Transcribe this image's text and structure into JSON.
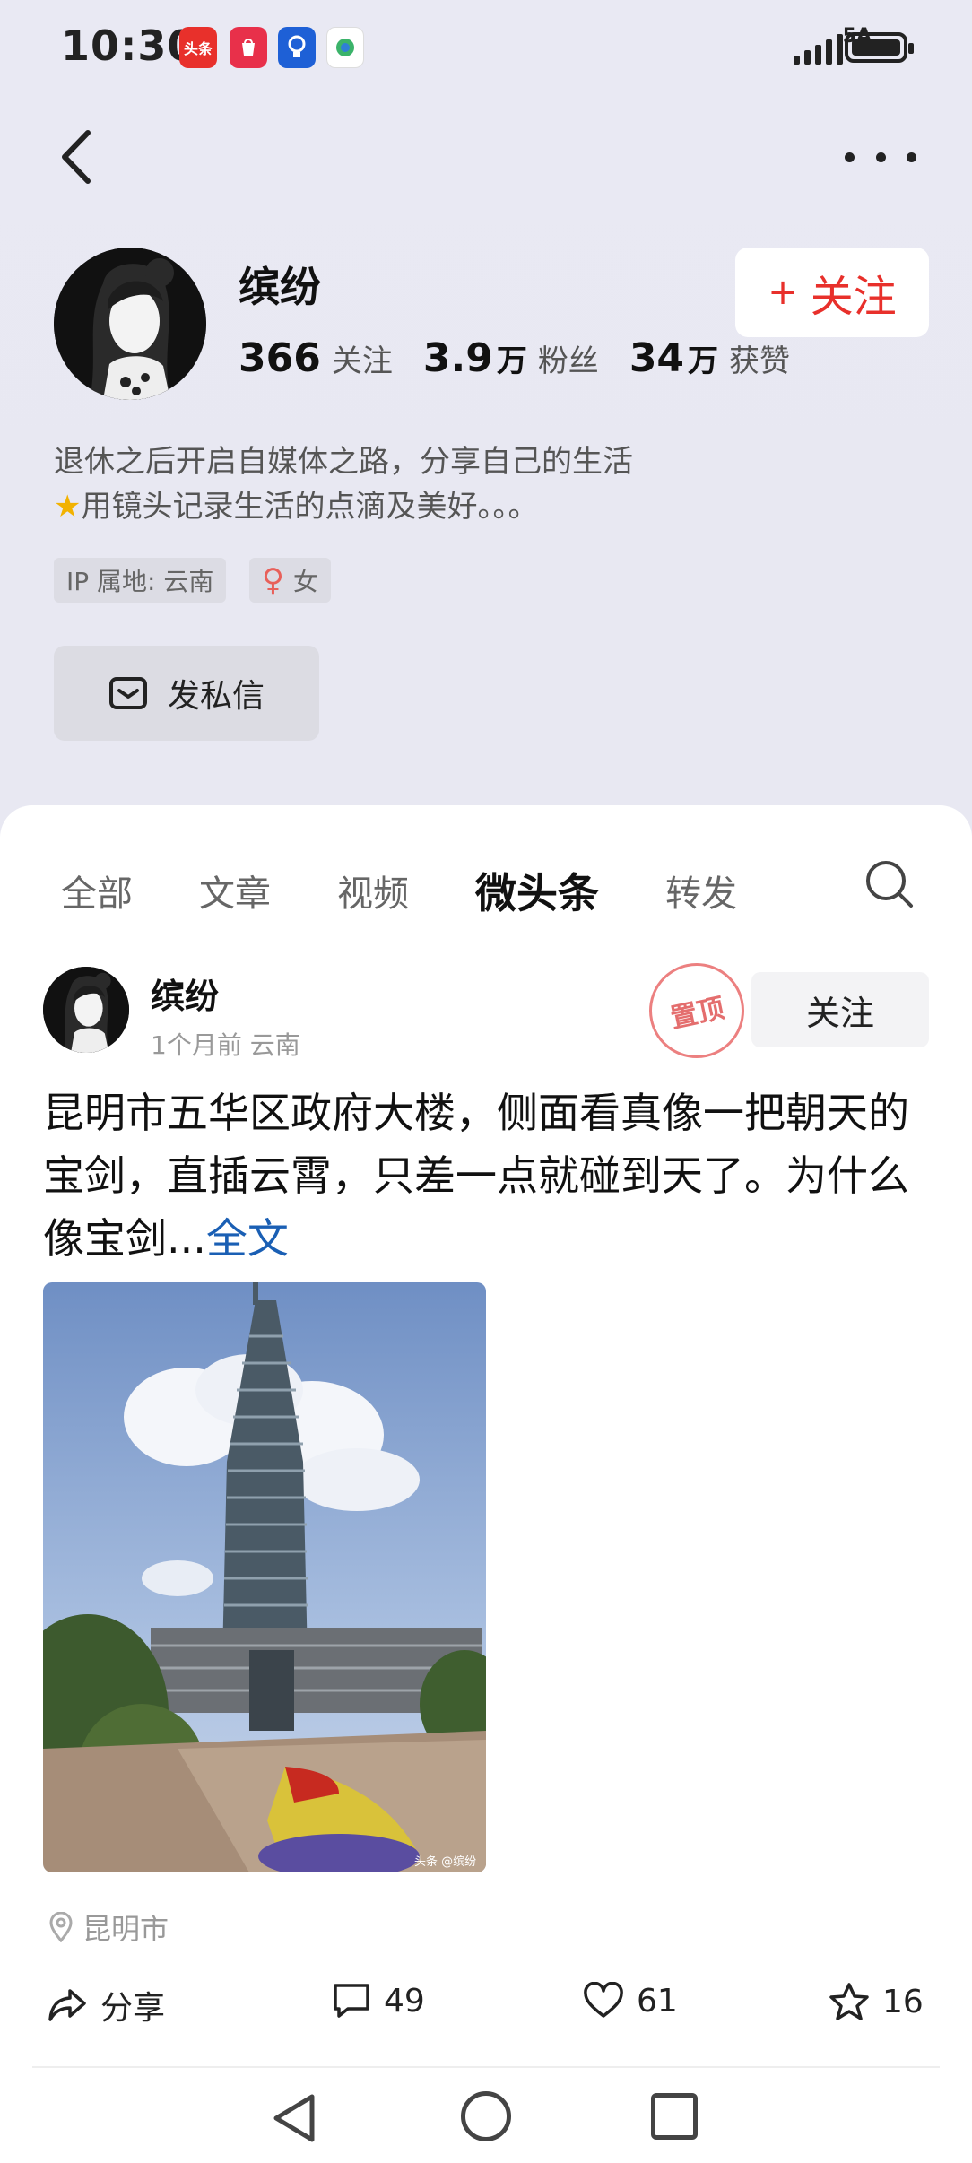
{
  "status_bar": {
    "time": "10:30",
    "network": "5A",
    "toutiao_icon_label": "头条",
    "appgallery_icon_label": "App Gallery"
  },
  "profile": {
    "name": "缤纷",
    "stats": [
      {
        "num": "366",
        "unit": "",
        "label": "关注"
      },
      {
        "num": "3.9",
        "unit": "万",
        "label": "粉丝"
      },
      {
        "num": "34",
        "unit": "万",
        "label": "获赞"
      }
    ],
    "follow_label": "关注",
    "bio_line1": "退休之后开启自媒体之路，分享自己的生活",
    "bio_line2": "用镜头记录生活的点滴及美好。。。",
    "ip_tag": "IP 属地: 云南",
    "gender_tag": "女",
    "dm_label": "发私信"
  },
  "tabs": [
    "全部",
    "文章",
    "视频",
    "微头条",
    "转发"
  ],
  "active_tab": "微头条",
  "post": {
    "author": "缤纷",
    "meta": "1个月前 云南",
    "pinned_stamp": "置顶",
    "follow_label": "关注",
    "text": "昆明市五华区政府大楼，侧面看真像一把朝天的宝剑，直插云霄，只差一点就碰到天了。为什么像宝剑...",
    "more_link": "全文",
    "image_watermark": "头条 @缤纷",
    "location": "昆明市",
    "share_label": "分享",
    "comments": "49",
    "likes": "61",
    "favorites": "16"
  },
  "colors": {
    "accent_red": "#e8302b",
    "link_blue": "#1a5fb4"
  }
}
